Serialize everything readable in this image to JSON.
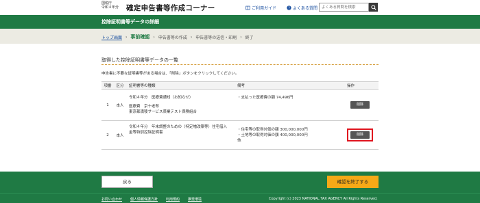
{
  "header": {
    "agency_line1": "国税庁",
    "agency_line2": "令和４年分",
    "site_title": "確定申告書等作成コーナー",
    "guide_link": "ご利用ガイド",
    "faq_link": "よくある質問",
    "search_placeholder": "よくある質問を検索"
  },
  "page": {
    "title": "控除証明書等データの詳細"
  },
  "breadcrumb": {
    "items": [
      "トップ画面",
      "事前確認",
      "申告書等の作成",
      "申告書等の送信・印刷",
      "終了"
    ]
  },
  "main": {
    "section_title": "取得した控除証明書等データの一覧",
    "instruction": "申告書に不要な証明書等がある場合は、「削除」ボタンをクリックしてください。",
    "table": {
      "headers": [
        "項番",
        "区分",
        "証明書等の種類",
        "備考",
        "操作"
      ],
      "rows": [
        {
          "no": "1",
          "category": "本人",
          "type_line1": "令和４年分　医療費通知（お知らせ）",
          "type_line2": "医療費　京十老郎",
          "type_line3": "東京都満稜サービス菜業テスト保険組合",
          "note_line1": "・支払った医療費の額 74,496円",
          "note_line2": "",
          "note_line3": "",
          "action": "削除"
        },
        {
          "no": "2",
          "category": "本人",
          "type_line1": "令和４年分　年末調整のための（特定増改築等）住宅借入",
          "type_line2": "金等特別控除証明書",
          "type_line3": "",
          "note_line1": "・住宅等の取得対価の額 300,000,000円",
          "note_line2": "・土地等の取得対価の額 400,000,000円",
          "note_line3": "他",
          "action": "削除"
        }
      ]
    }
  },
  "footer": {
    "back_label": "戻る",
    "finish_label": "確認を終了する",
    "links": [
      "お問い合わせ",
      "個人情報保護方針",
      "利用規約",
      "推奨環境"
    ],
    "copyright": "Copyright (c) 2023 NATIONAL TAX AGENCY All Rights Reserved."
  },
  "colors": {
    "green": "#1f7a44",
    "orange": "#f6a917",
    "highlight_red": "#e0141e"
  }
}
